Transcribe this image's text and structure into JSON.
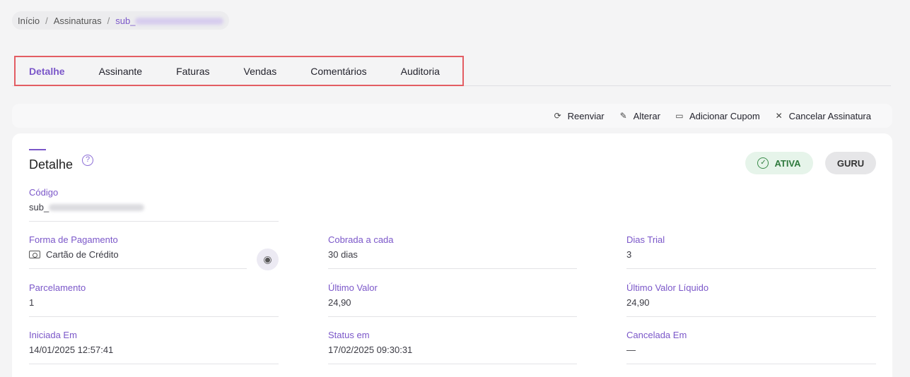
{
  "breadcrumb": {
    "home": "Início",
    "section": "Assinaturas",
    "current_prefix": "sub_"
  },
  "tabs": [
    {
      "label": "Detalhe",
      "active": true
    },
    {
      "label": "Assinante"
    },
    {
      "label": "Faturas"
    },
    {
      "label": "Vendas"
    },
    {
      "label": "Comentários"
    },
    {
      "label": "Auditoria"
    }
  ],
  "actions": {
    "resend": {
      "label": "Reenviar",
      "icon": "refresh-icon"
    },
    "edit": {
      "label": "Alterar",
      "icon": "edit-icon"
    },
    "coupon": {
      "label": "Adicionar Cupom",
      "icon": "ticket-icon"
    },
    "cancel": {
      "label": "Cancelar Assinatura",
      "icon": "close-icon"
    }
  },
  "detail": {
    "title": "Detalhe",
    "status_badge": "ATIVA",
    "source_badge": "GURU",
    "code": {
      "label": "Código",
      "value_prefix": "sub_"
    },
    "payment": {
      "label": "Forma de Pagamento",
      "value": "Cartão de Crédito"
    },
    "charged_every": {
      "label": "Cobrada a cada",
      "value": "30 dias"
    },
    "trial_days": {
      "label": "Dias Trial",
      "value": "3"
    },
    "installments": {
      "label": "Parcelamento",
      "value": "1"
    },
    "last_value": {
      "label": "Último Valor",
      "value": "24,90"
    },
    "last_net_value": {
      "label": "Último Valor Líquido",
      "value": "24,90"
    },
    "started_at": {
      "label": "Iniciada Em",
      "value": "14/01/2025 12:57:41"
    },
    "status_at": {
      "label": "Status em",
      "value": "17/02/2025 09:30:31"
    },
    "cancelled_at": {
      "label": "Cancelada Em",
      "value": "—"
    }
  },
  "colors": {
    "accent": "#7b57c9",
    "success": "#2f7a3e",
    "highlight_border": "#e35d63"
  }
}
